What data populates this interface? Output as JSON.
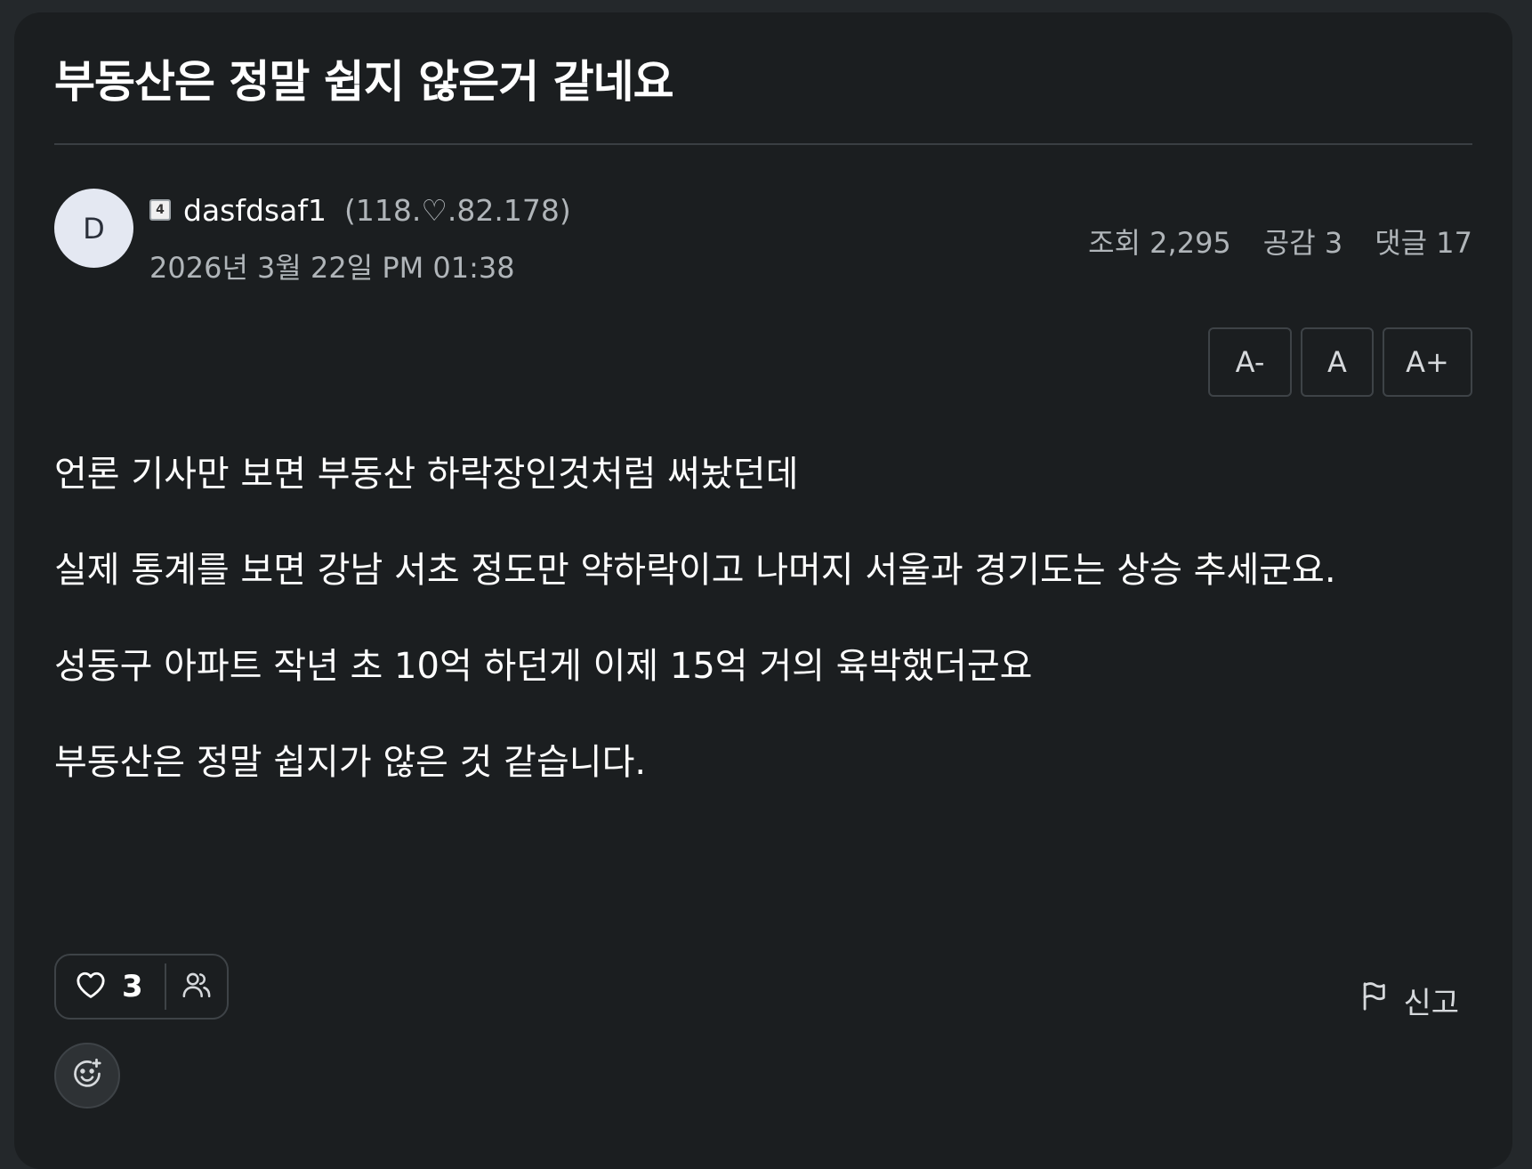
{
  "post": {
    "title": "부동산은 정말 쉽지 않은거 같네요",
    "author": {
      "avatar_initial": "D",
      "level_badge": "4",
      "username": "dasfdsaf1",
      "ip": "(118.♡.82.178)"
    },
    "date": "2026년 3월 22일 PM 01:38",
    "stats": {
      "views": "조회 2,295",
      "likes": "공감 3",
      "comments": "댓글 17"
    },
    "font_controls": {
      "decrease": "A-",
      "normal": "A",
      "increase": "A+"
    },
    "paragraphs": [
      "언론 기사만 보면 부동산 하락장인것처럼 써놨던데",
      "실제 통계를 보면 강남 서초 정도만 약하락이고 나머지 서울과 경기도는 상승 추세군요.",
      "성동구 아파트 작년 초 10억 하던게 이제 15억 거의 육박했더군요",
      "부동산은 정말 쉽지가 않은 것 같습니다."
    ],
    "actions": {
      "like_count": "3",
      "report_label": "신고"
    },
    "icons": {
      "like": "heart-icon",
      "likers": "people-icon",
      "report": "flag-icon",
      "emoji": "add-emoji-icon"
    }
  }
}
